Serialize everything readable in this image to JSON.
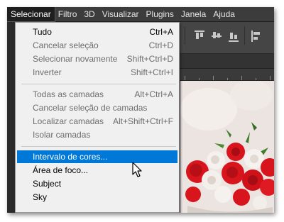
{
  "menubar": {
    "items": [
      "Selecionar",
      "Filtro",
      "3D",
      "Visualizar",
      "Plugins",
      "Janela",
      "Ajuda"
    ],
    "active_index": 0
  },
  "menu": {
    "groups": [
      {
        "items": [
          {
            "label": "Tudo",
            "shortcut": "Ctrl+A",
            "enabled": true
          },
          {
            "label": "Cancelar seleção",
            "shortcut": "Ctrl+D",
            "enabled": false
          },
          {
            "label": "Selecionar novamente",
            "shortcut": "Shift+Ctrl+D",
            "enabled": false
          },
          {
            "label": "Inverter",
            "shortcut": "Shift+Ctrl+I",
            "enabled": false
          }
        ]
      },
      {
        "items": [
          {
            "label": "Todas as camadas",
            "shortcut": "Alt+Ctrl+A",
            "enabled": false
          },
          {
            "label": "Cancelar seleção de camadas",
            "shortcut": "",
            "enabled": false
          },
          {
            "label": "Localizar camadas",
            "shortcut": "Alt+Shift+Ctrl+F",
            "enabled": false
          },
          {
            "label": "Isolar camadas",
            "shortcut": "",
            "enabled": false
          }
        ]
      },
      {
        "items": [
          {
            "label": "Intervalo de cores...",
            "shortcut": "",
            "enabled": true,
            "highlighted": true
          },
          {
            "label": "Área de foco...",
            "shortcut": "",
            "enabled": true
          },
          {
            "label": "Subject",
            "shortcut": "",
            "enabled": true
          },
          {
            "label": "Sky",
            "shortcut": "",
            "enabled": true
          }
        ]
      }
    ]
  },
  "colors": {
    "menubar_bg": "#3c3c3c",
    "menu_bg": "#f0f0f0",
    "highlight": "#0078d7",
    "disabled_text": "#6d6d6d",
    "rose_red": "#d8141c",
    "rose_white": "#f4f1ee",
    "leaf_green": "#3f7d2a"
  },
  "icons": {
    "cursor": "arrow-cursor-icon",
    "align": "align-top-icon"
  }
}
